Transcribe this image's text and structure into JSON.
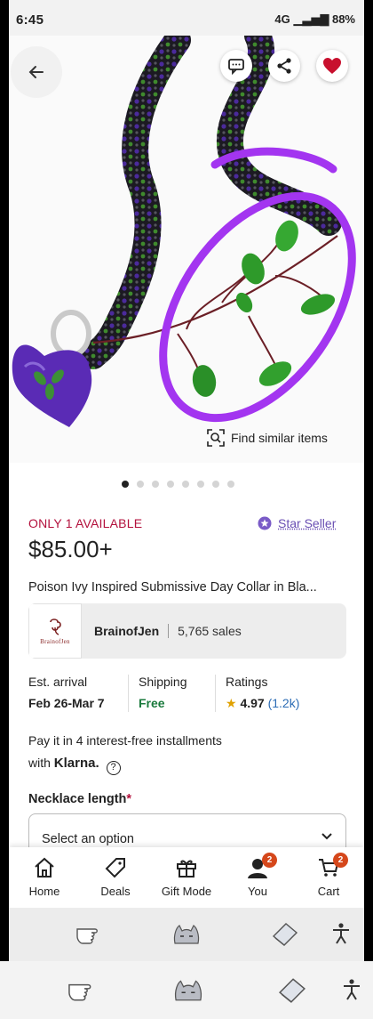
{
  "status_bar": {
    "time": "6:45",
    "signal": "4G",
    "battery": "88%"
  },
  "hero": {
    "find_similar_label": "Find similar items",
    "image_count": 8,
    "active_image": 0
  },
  "listing": {
    "stock": "ONLY 1 AVAILABLE",
    "star_seller": "Star Seller",
    "price": "$85.00+",
    "title": "Poison Ivy Inspired Submissive Day Collar in Bla..."
  },
  "shop": {
    "logo_text": "BrainofJen",
    "name": "BrainofJen",
    "sales": "5,765 sales"
  },
  "details": {
    "arrival_label": "Est. arrival",
    "arrival_value": "Feb 26-Mar 7",
    "shipping_label": "Shipping",
    "shipping_value": "Free",
    "ratings_label": "Ratings",
    "rating_value": "4.97",
    "rating_count": "(1.2k)"
  },
  "klarna": {
    "line1": "Pay it in 4 interest-free installments",
    "line2": "with",
    "brand": "Klarna."
  },
  "options": {
    "label": "Necklace length",
    "required_mark": "*",
    "select_placeholder": "Select an option"
  },
  "bottom_nav": [
    {
      "label": "Home",
      "icon": "home-icon"
    },
    {
      "label": "Deals",
      "icon": "tag-icon"
    },
    {
      "label": "Gift Mode",
      "icon": "gift-icon"
    },
    {
      "label": "You",
      "icon": "user-icon",
      "badge": "2"
    },
    {
      "label": "Cart",
      "icon": "cart-icon",
      "badge": "2"
    }
  ],
  "colors": {
    "accent_red": "#b3103c",
    "star_seller_purple": "#6a4fb3",
    "free_green": "#1a7a3c",
    "badge_orange": "#d5471b",
    "annotation_purple": "#a335f0"
  }
}
